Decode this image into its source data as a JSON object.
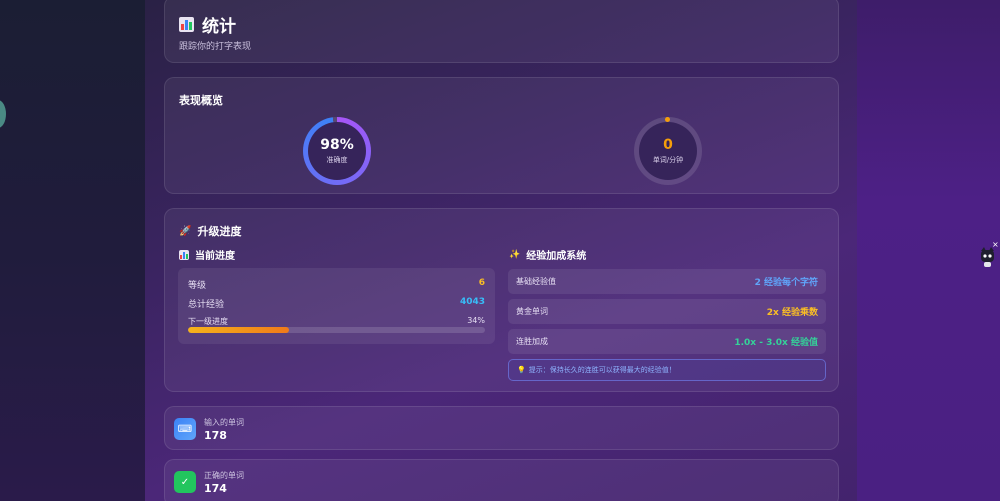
{
  "header": {
    "title": "统计",
    "subtitle": "跟踪你的打字表现"
  },
  "overview": {
    "title": "表现概览",
    "accuracy": {
      "value": "98%",
      "label": "准确度",
      "percent": 98
    },
    "wpm": {
      "value": "0",
      "label": "单词/分钟",
      "percent": 0
    }
  },
  "level_progress": {
    "title": "升级进度",
    "current": {
      "title": "当前进度",
      "level_label": "等级",
      "level_value": "6",
      "xp_label": "总计经验",
      "xp_value": "4043",
      "next_label": "下一级进度",
      "next_value": "34%",
      "next_percent": 34
    },
    "bonus": {
      "title": "经验加成系统",
      "rows": [
        {
          "label": "基础经验值",
          "value": "2 经验每个字符",
          "color": "#60a5fa"
        },
        {
          "label": "黄金单词",
          "value": "2x 经验乘数",
          "color": "#fbbf24"
        },
        {
          "label": "连胜加成",
          "value": "1.0x - 3.0x 经验值",
          "color": "#34d399"
        }
      ],
      "tip": "提示：保持长久的连胜可以获得最大的经验值！"
    }
  },
  "stats": [
    {
      "label": "输入的单词",
      "value": "178",
      "icon": "keyboard-icon"
    },
    {
      "label": "正确的单词",
      "value": "174",
      "icon": "checkmark-icon"
    }
  ],
  "colors": {
    "accuracy_ring_start": "#a855f7",
    "accuracy_ring_end": "#3b82f6",
    "wpm_accent": "#f59e0b",
    "level": "#fbbf24",
    "xp": "#38bdf8"
  }
}
